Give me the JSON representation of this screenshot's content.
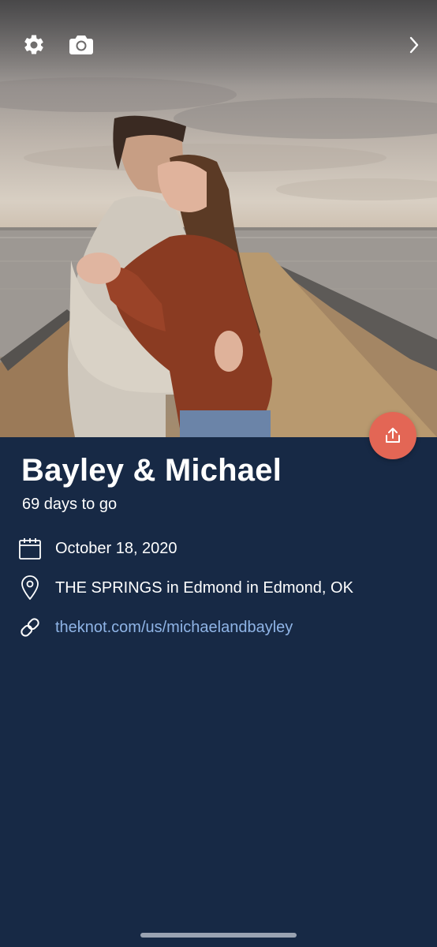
{
  "header": {
    "settings_icon": "gear-icon",
    "camera_icon": "camera-icon",
    "next_icon": "chevron-right-icon"
  },
  "share": {
    "icon": "share-upload-icon",
    "color": "#e36655"
  },
  "event": {
    "couple_name": "Bayley & Michael",
    "countdown": "69 days to go",
    "date": "October 18, 2020",
    "venue": "THE SPRINGS in Edmond in Edmond, OK",
    "website": "theknot.com/us/michaelandbayley"
  },
  "icons": {
    "date": "calendar-icon",
    "venue": "location-pin-icon",
    "website": "link-icon"
  },
  "colors": {
    "background": "#172945",
    "link": "#8fb4e6",
    "text": "#ffffff"
  }
}
